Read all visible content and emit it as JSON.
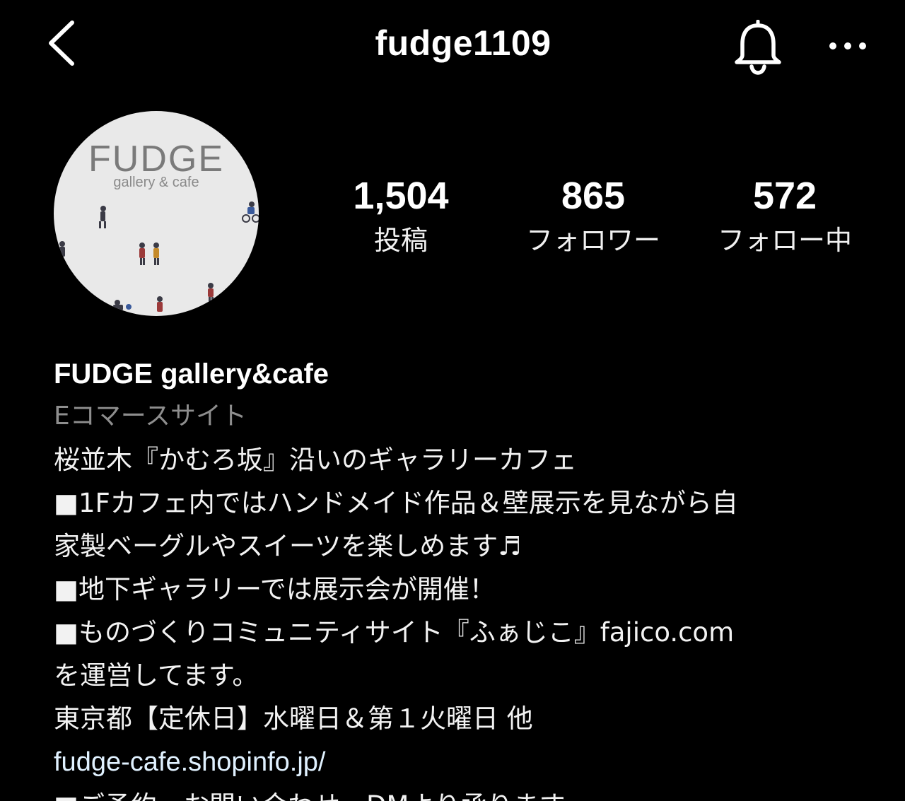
{
  "header": {
    "username": "fudge1109",
    "back_icon": "chevron-left-icon",
    "bell_icon": "bell-icon",
    "more_icon": "ellipsis-icon"
  },
  "profile": {
    "avatar": {
      "wordmark": "FUDGE",
      "tagline": "gallery & cafe"
    },
    "stats": [
      {
        "value": "1,504",
        "label": "投稿"
      },
      {
        "value": "865",
        "label": "フォロワー"
      },
      {
        "value": "572",
        "label": "フォロー中"
      }
    ]
  },
  "bio": {
    "name": "FUDGE gallery&cafe",
    "category": "Eコマースサイト",
    "lines": [
      "桜並木『かむろ坂』沿いのギャラリーカフェ",
      "■1Fカフェ内ではハンドメイド作品＆壁展示を見ながら自",
      "家製ベーグルやスイーツを楽しめます♬",
      "■地下ギャラリーでは展示会が開催！",
      "■ものづくりコミュニティサイト『ふぁじこ』fajico.com",
      "を運営してます。",
      "東京都【定休日】水曜日＆第１火曜日 他"
    ],
    "link": "fudge-cafe.shopinfo.jp/",
    "partial_line": "■ご予約・お問い合わせ　DMより承ります"
  },
  "colors": {
    "background": "#000000",
    "text": "#f5f5f5",
    "category": "#8e8e8e",
    "link": "#e0f1ff"
  }
}
